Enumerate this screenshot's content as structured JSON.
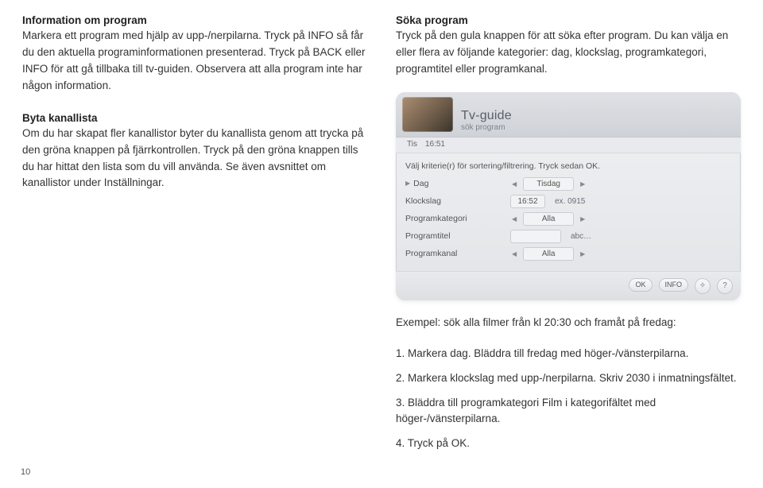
{
  "left": {
    "section1_heading": "Information om program",
    "section1_text": "Markera ett program med hjälp av upp-/nerpilarna. Tryck på INFO så får du den aktuella programinformationen presenterad. Tryck på BACK eller INFO för att gå tillbaka till tv-guiden. Observera att alla program inte har någon information.",
    "section2_heading": "Byta kanallista",
    "section2_text": "Om du har skapat fler kanallistor byter du kanallista genom att trycka på den gröna knappen på fjärrkontrollen. Tryck på den gröna knappen tills du har hittat den lista som du vill använda. Se även avsnittet om kanallistor under Inställningar."
  },
  "right": {
    "section1_heading": "Söka program",
    "section1_text": "Tryck på den gula knappen för att söka efter program. Du kan välja en eller flera av följande kategorier: dag, klockslag, programkategori, programtitel eller programkanal.",
    "example_intro": "Exempel: sök alla filmer från kl 20:30 och framåt på fredag:",
    "steps": {
      "s1": "1. Markera dag. Bläddra till fredag med höger-/vänsterpilarna.",
      "s2": "2. Markera klockslag med upp-/nerpilarna. Skriv 2030 i inmatningsfältet.",
      "s3": "3. Bläddra till programkategori Film i kategorifältet med höger-/vänsterpilarna.",
      "s4": "4. Tryck på OK."
    }
  },
  "tvguide": {
    "title": "Tv-guide",
    "subtitle": "sök program",
    "meta_day": "Tis",
    "meta_time": "16:51",
    "hint": "Välj kriterie(r) för sortering/filtrering. Tryck sedan OK.",
    "rows": {
      "dag_label": "Dag",
      "dag_value": "Tisdag",
      "klockslag_label": "Klockslag",
      "klockslag_value": "16:52",
      "klockslag_note": "ex. 0915",
      "kategori_label": "Programkategori",
      "kategori_value": "Alla",
      "titel_label": "Programtitel",
      "titel_note": "abc…",
      "kanal_label": "Programkanal",
      "kanal_value": "Alla"
    },
    "footer": {
      "ok": "OK",
      "info": "INFO",
      "nav": "✧",
      "help": "?"
    }
  },
  "page_number": "10"
}
